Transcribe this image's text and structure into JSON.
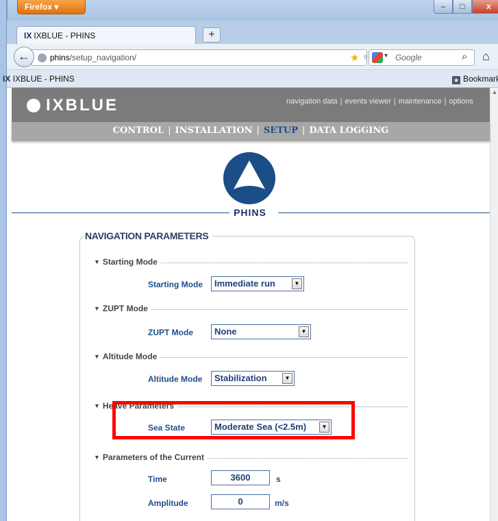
{
  "browser": {
    "app_button": "Firefox ▾",
    "window_controls": {
      "minimize": "–",
      "maximize": "□",
      "close": "x"
    },
    "tab": {
      "logo": "IX",
      "title": "IXBLUE - PHINS",
      "new_tab": "+"
    },
    "url": {
      "host": "phins",
      "path": "/setup_navigation/"
    },
    "search": {
      "placeholder": "Google"
    },
    "bookmarks_bar": {
      "item_logo": "IX",
      "item_label": "IXBLUE - PHINS",
      "bookmarks_label": "Bookmarks"
    }
  },
  "site": {
    "logo_text": "IXBLUE",
    "top_links": [
      "navigation data",
      "events viewer",
      "maintenance",
      "options"
    ],
    "main_nav": [
      "CONTROL",
      "INSTALLATION",
      "SETUP",
      "DATA LOGGING"
    ],
    "active_nav": "SETUP",
    "product_name": "PHINS"
  },
  "panel": {
    "title": "NAVIGATION PARAMETERS",
    "sections": [
      {
        "title": "Starting Mode",
        "field_label": "Starting Mode",
        "value": "Immediate run"
      },
      {
        "title": "ZUPT Mode",
        "field_label": "ZUPT Mode",
        "value": "None"
      },
      {
        "title": "Altitude Mode",
        "field_label": "Altitude Mode",
        "value": "Stabilization"
      },
      {
        "title": "Heave Parameters",
        "field_label": "Sea State",
        "value": "Moderate Sea (<2.5m)"
      },
      {
        "title": "Parameters of the Current",
        "fields": [
          {
            "label": "Time",
            "value": "3600",
            "unit": "s"
          },
          {
            "label": "Amplitude",
            "value": "0",
            "unit": "m/s"
          }
        ]
      }
    ]
  },
  "colors": {
    "brand_blue": "#1b4d86",
    "active_nav": "#1f4d8c",
    "header_gray": "#7b7b7b",
    "highlight": "#ff0000"
  }
}
